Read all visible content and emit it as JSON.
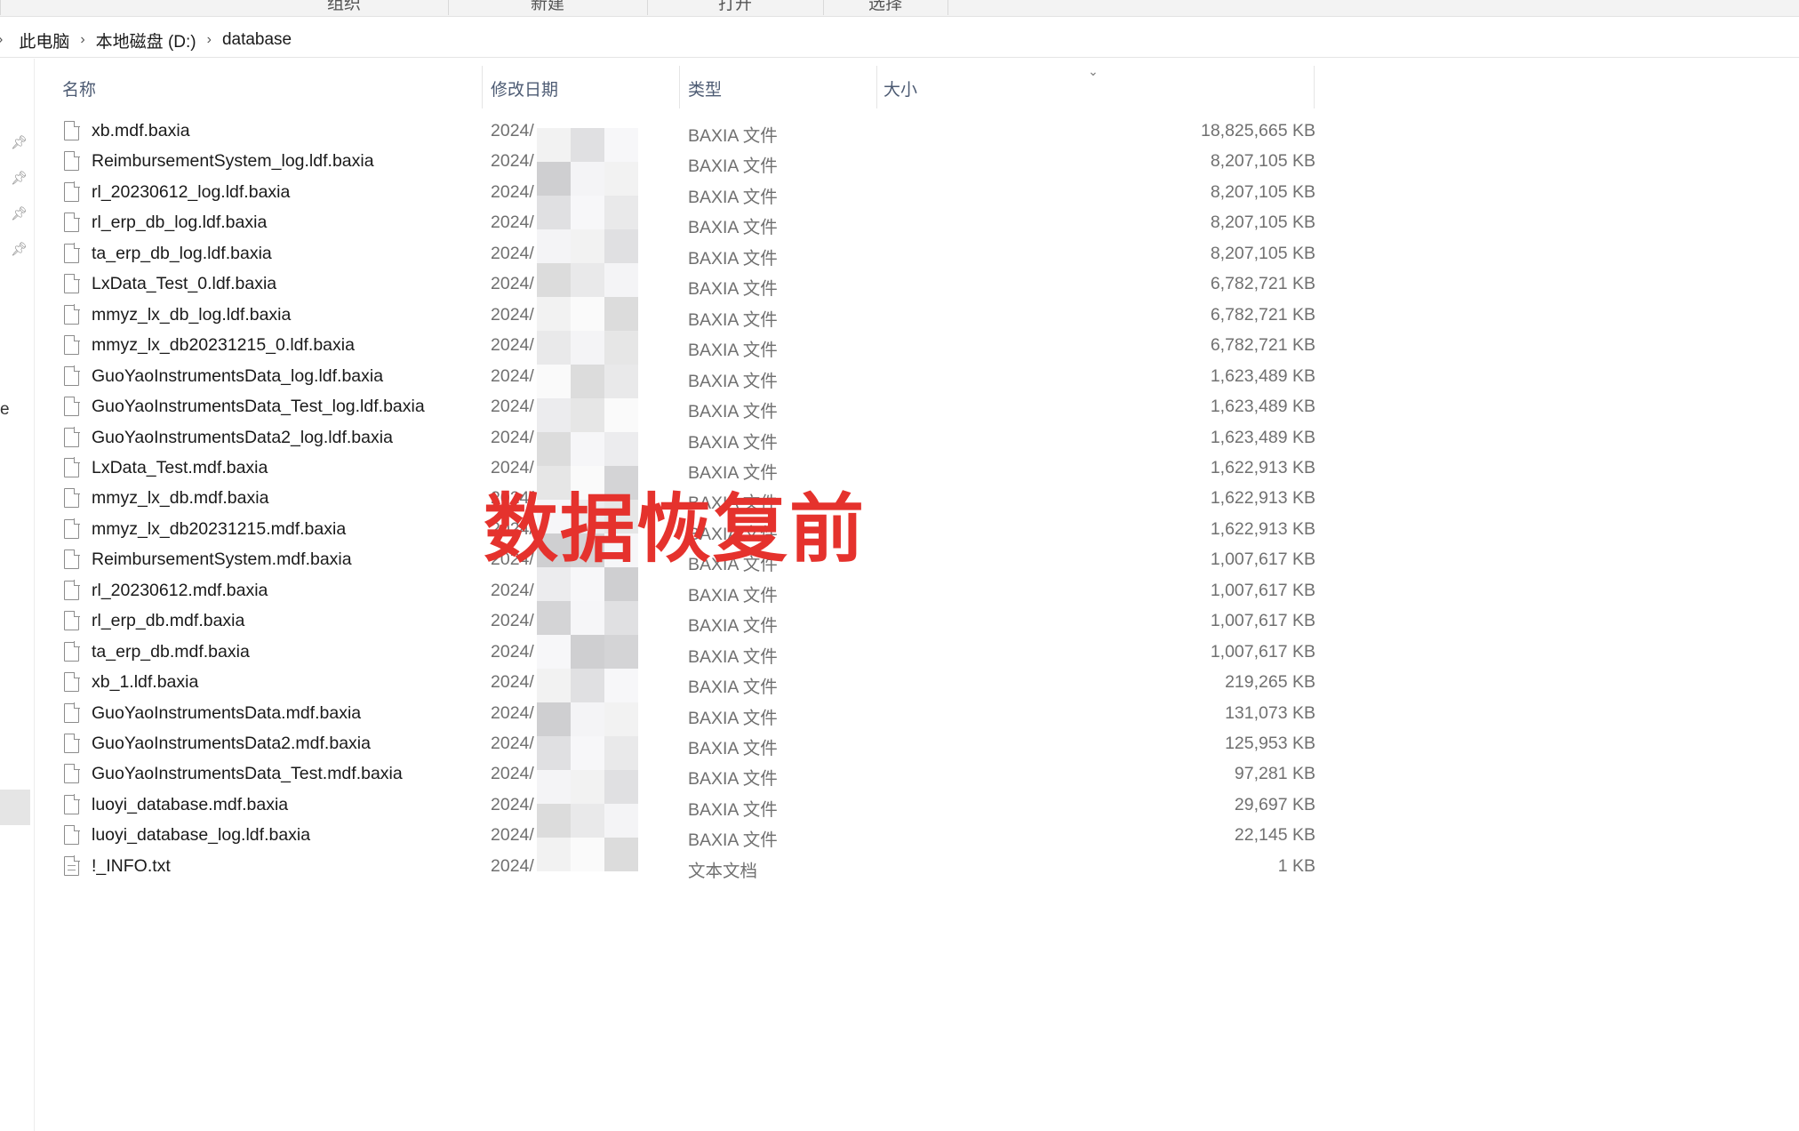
{
  "ribbon": {
    "groups": [
      {
        "label": "组织"
      },
      {
        "label": "新建"
      },
      {
        "label": "打开"
      },
      {
        "label": "选择"
      }
    ]
  },
  "address": {
    "crumbs": [
      "此电脑",
      "本地磁盘 (D:)",
      "database"
    ]
  },
  "nav": {
    "partial_label": "e"
  },
  "columns": {
    "name": "名称",
    "date": "修改日期",
    "type": "类型",
    "size": "大小"
  },
  "icons": {
    "file": "file-icon",
    "text": "text-document-icon",
    "pin": "pin-icon",
    "chevron": "chevron-right-icon",
    "sort": "sort-chevron-down-icon"
  },
  "overlay": {
    "caption": "数据恢复前",
    "color": "#e5322d"
  },
  "files": [
    {
      "name": "xb.mdf.baxia",
      "date": "2024/",
      "type": "BAXIA 文件",
      "size": "18,825,665 KB",
      "icon": "file"
    },
    {
      "name": "ReimbursementSystem_log.ldf.baxia",
      "date": "2024/",
      "type": "BAXIA 文件",
      "size": "8,207,105 KB",
      "icon": "file"
    },
    {
      "name": "rl_20230612_log.ldf.baxia",
      "date": "2024/",
      "type": "BAXIA 文件",
      "size": "8,207,105 KB",
      "icon": "file"
    },
    {
      "name": "rl_erp_db_log.ldf.baxia",
      "date": "2024/",
      "type": "BAXIA 文件",
      "size": "8,207,105 KB",
      "icon": "file"
    },
    {
      "name": "ta_erp_db_log.ldf.baxia",
      "date": "2024/",
      "type": "BAXIA 文件",
      "size": "8,207,105 KB",
      "icon": "file"
    },
    {
      "name": "LxData_Test_0.ldf.baxia",
      "date": "2024/",
      "type": "BAXIA 文件",
      "size": "6,782,721 KB",
      "icon": "file"
    },
    {
      "name": "mmyz_lx_db_log.ldf.baxia",
      "date": "2024/",
      "type": "BAXIA 文件",
      "size": "6,782,721 KB",
      "icon": "file"
    },
    {
      "name": "mmyz_lx_db20231215_0.ldf.baxia",
      "date": "2024/",
      "type": "BAXIA 文件",
      "size": "6,782,721 KB",
      "icon": "file"
    },
    {
      "name": "GuoYaoInstrumentsData_log.ldf.baxia",
      "date": "2024/",
      "type": "BAXIA 文件",
      "size": "1,623,489 KB",
      "icon": "file"
    },
    {
      "name": "GuoYaoInstrumentsData_Test_log.ldf.baxia",
      "date": "2024/",
      "type": "BAXIA 文件",
      "size": "1,623,489 KB",
      "icon": "file"
    },
    {
      "name": "GuoYaoInstrumentsData2_log.ldf.baxia",
      "date": "2024/",
      "type": "BAXIA 文件",
      "size": "1,623,489 KB",
      "icon": "file"
    },
    {
      "name": "LxData_Test.mdf.baxia",
      "date": "2024/",
      "type": "BAXIA 文件",
      "size": "1,622,913 KB",
      "icon": "file"
    },
    {
      "name": "mmyz_lx_db.mdf.baxia",
      "date": "2024/",
      "type": "BAXIA 文件",
      "size": "1,622,913 KB",
      "icon": "file"
    },
    {
      "name": "mmyz_lx_db20231215.mdf.baxia",
      "date": "2024/",
      "type": "BAXIA 文件",
      "size": "1,622,913 KB",
      "icon": "file"
    },
    {
      "name": "ReimbursementSystem.mdf.baxia",
      "date": "2024/",
      "type": "BAXIA 文件",
      "size": "1,007,617 KB",
      "icon": "file"
    },
    {
      "name": "rl_20230612.mdf.baxia",
      "date": "2024/",
      "type": "BAXIA 文件",
      "size": "1,007,617 KB",
      "icon": "file"
    },
    {
      "name": "rl_erp_db.mdf.baxia",
      "date": "2024/",
      "type": "BAXIA 文件",
      "size": "1,007,617 KB",
      "icon": "file"
    },
    {
      "name": "ta_erp_db.mdf.baxia",
      "date": "2024/",
      "type": "BAXIA 文件",
      "size": "1,007,617 KB",
      "icon": "file"
    },
    {
      "name": "xb_1.ldf.baxia",
      "date": "2024/",
      "type": "BAXIA 文件",
      "size": "219,265 KB",
      "icon": "file"
    },
    {
      "name": "GuoYaoInstrumentsData.mdf.baxia",
      "date": "2024/",
      "type": "BAXIA 文件",
      "size": "131,073 KB",
      "icon": "file"
    },
    {
      "name": "GuoYaoInstrumentsData2.mdf.baxia",
      "date": "2024/",
      "type": "BAXIA 文件",
      "size": "125,953 KB",
      "icon": "file"
    },
    {
      "name": "GuoYaoInstrumentsData_Test.mdf.baxia",
      "date": "2024/",
      "type": "BAXIA 文件",
      "size": "97,281 KB",
      "icon": "file"
    },
    {
      "name": "luoyi_database.mdf.baxia",
      "date": "2024/",
      "type": "BAXIA 文件",
      "size": "29,697 KB",
      "icon": "file"
    },
    {
      "name": "luoyi_database_log.ldf.baxia",
      "date": "2024/",
      "type": "BAXIA 文件",
      "size": "22,145 KB",
      "icon": "file"
    },
    {
      "name": "!_INFO.txt",
      "date": "2024/",
      "type": "文本文档",
      "size": "1 KB",
      "icon": "text"
    }
  ]
}
